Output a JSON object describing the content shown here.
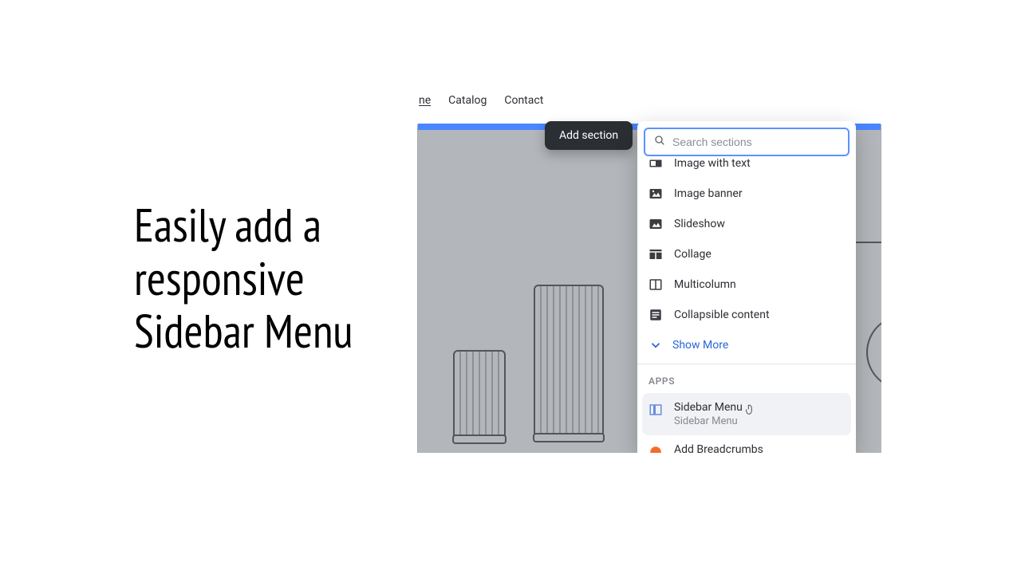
{
  "headline": "Easily add a responsive Sidebar Menu",
  "nav": {
    "home_partial": "ne",
    "catalog": "Catalog",
    "contact": "Contact"
  },
  "pill": "Add section",
  "search": {
    "placeholder": "Search sections"
  },
  "sections": {
    "image_with_text": "Image with text",
    "image_banner": "Image banner",
    "slideshow": "Slideshow",
    "collage": "Collage",
    "multicolumn": "Multicolumn",
    "collapsible": "Collapsible content",
    "show_more": "Show More"
  },
  "apps_header": "APPS",
  "apps": {
    "sidebar_menu": {
      "title": "Sidebar Menu",
      "sub": "Sidebar Menu"
    },
    "breadcrumbs": {
      "title": "Add Breadcrumbs"
    }
  }
}
